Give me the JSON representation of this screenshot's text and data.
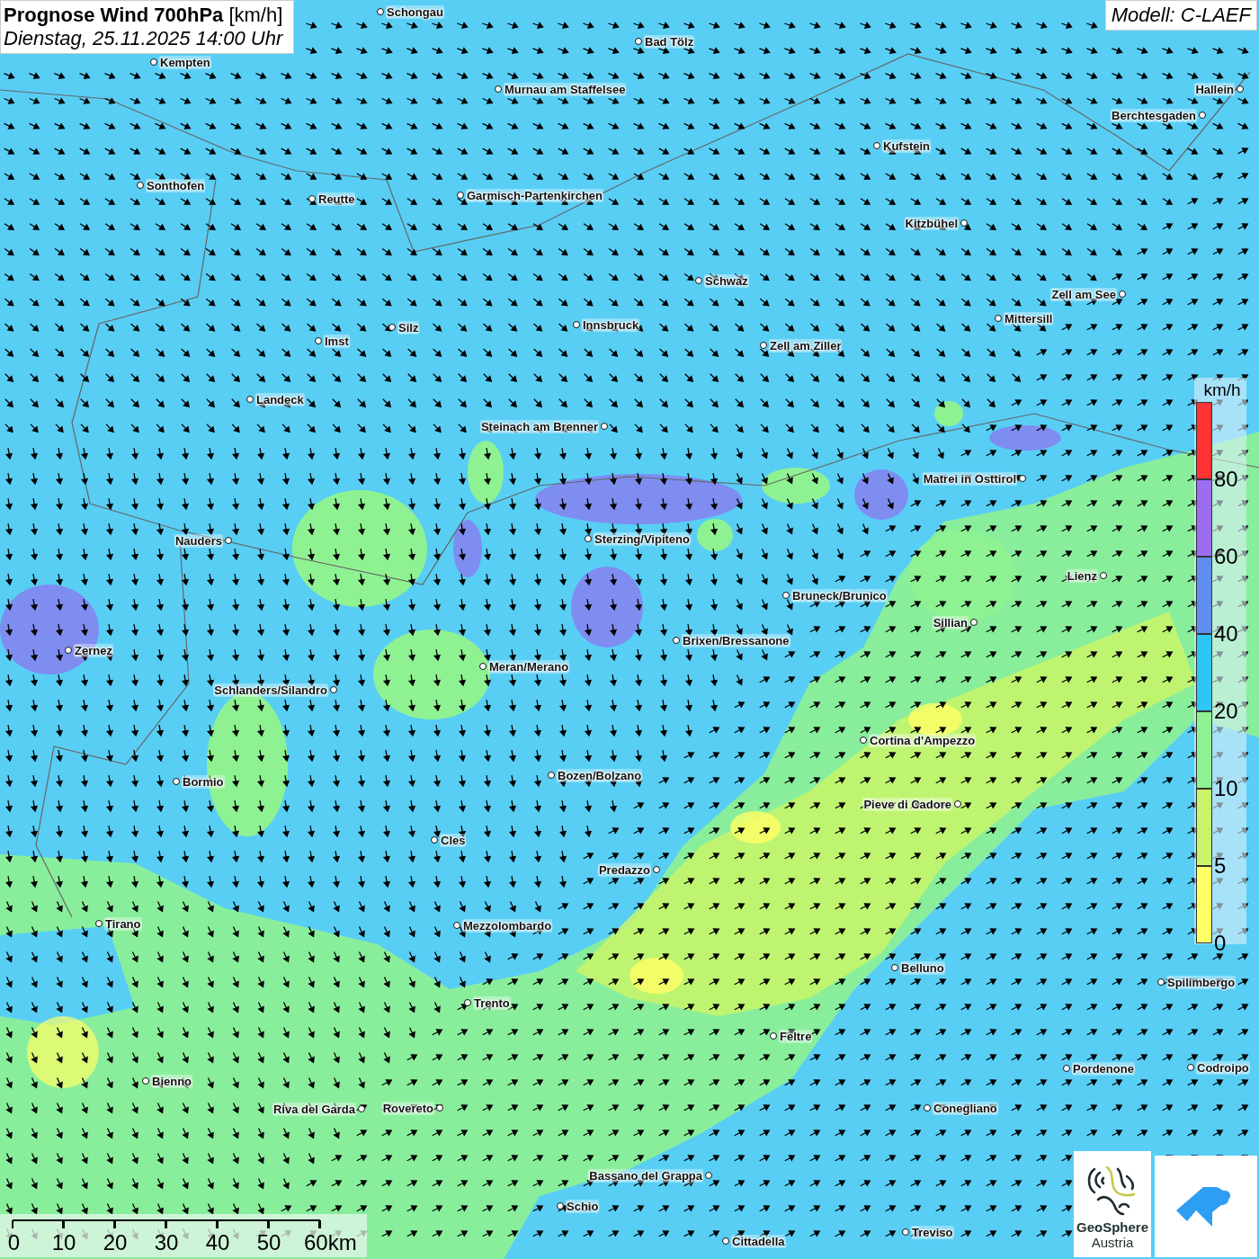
{
  "header": {
    "title": "**Prognose Wind 700hPa** [km/h]",
    "subtitle": "Dienstag, 25.11.2025 14:00 Uhr"
  },
  "model": "Modell: C-LAEF",
  "cities": [
    {
      "name": "Schongau"
    },
    {
      "name": "Bad Tölz"
    },
    {
      "name": "Kempten"
    },
    {
      "name": "Murnau am Staffelsee"
    },
    {
      "name": "Hallein"
    },
    {
      "name": "Berchtesgaden"
    },
    {
      "name": "Kufstein"
    },
    {
      "name": "Sonthofen"
    },
    {
      "name": "Reutte"
    },
    {
      "name": "Garmisch-Partenkirchen"
    },
    {
      "name": "Kitzbühel"
    },
    {
      "name": "Schwaz"
    },
    {
      "name": "Zell am See"
    },
    {
      "name": "Mittersill"
    },
    {
      "name": "Innsbruck"
    },
    {
      "name": "Silz"
    },
    {
      "name": "Imst"
    },
    {
      "name": "Zell am Ziller"
    },
    {
      "name": "Landeck"
    },
    {
      "name": "Steinach am Brenner"
    },
    {
      "name": "Matrei in Osttirol"
    },
    {
      "name": "Nauders"
    },
    {
      "name": "Sterzing/Vipiteno"
    },
    {
      "name": "Lienz"
    },
    {
      "name": "Bruneck/Brunico"
    },
    {
      "name": "Sillian"
    },
    {
      "name": "Brixen/Bressanone"
    },
    {
      "name": "Zernez"
    },
    {
      "name": "Meran/Merano"
    },
    {
      "name": "Schlanders/Silandro"
    },
    {
      "name": "Cortina d'Ampezzo"
    },
    {
      "name": "Bozen/Bolzano"
    },
    {
      "name": "Bormio"
    },
    {
      "name": "Pieve di Cadore"
    },
    {
      "name": "Cles"
    },
    {
      "name": "Predazzo"
    },
    {
      "name": "Tirano"
    },
    {
      "name": "Mezzolombardo"
    },
    {
      "name": "Belluno"
    },
    {
      "name": "Spilimbergo"
    },
    {
      "name": "Trento"
    },
    {
      "name": "Feltre"
    },
    {
      "name": "Pordenone"
    },
    {
      "name": "Codroipo"
    },
    {
      "name": "Bienno"
    },
    {
      "name": "Riva del Garda"
    },
    {
      "name": "Rovereto"
    },
    {
      "name": "Conegliano"
    },
    {
      "name": "Bassano del Grappa"
    },
    {
      "name": "Schio"
    },
    {
      "name": "Treviso"
    },
    {
      "name": "Cittadella"
    }
  ],
  "legend": {
    "unit": "km/h",
    "bins": [
      {
        "color": "#ff3333",
        "label": "80"
      },
      {
        "color": "#9d6cf2",
        "label": "60"
      },
      {
        "color": "#5f8ef2",
        "label": "40"
      },
      {
        "color": "#2ec6f7",
        "label": "20"
      },
      {
        "color": "#8ff292",
        "label": "10"
      },
      {
        "color": "#c9f46a",
        "label": "5"
      },
      {
        "color": "#ffff66",
        "label": "0"
      }
    ]
  },
  "scale_bar": {
    "labels": [
      "0",
      "10",
      "20",
      "30",
      "40",
      "50",
      "60km"
    ]
  },
  "logo": {
    "line_1": "GeoSphere",
    "line_2": "Austria"
  }
}
